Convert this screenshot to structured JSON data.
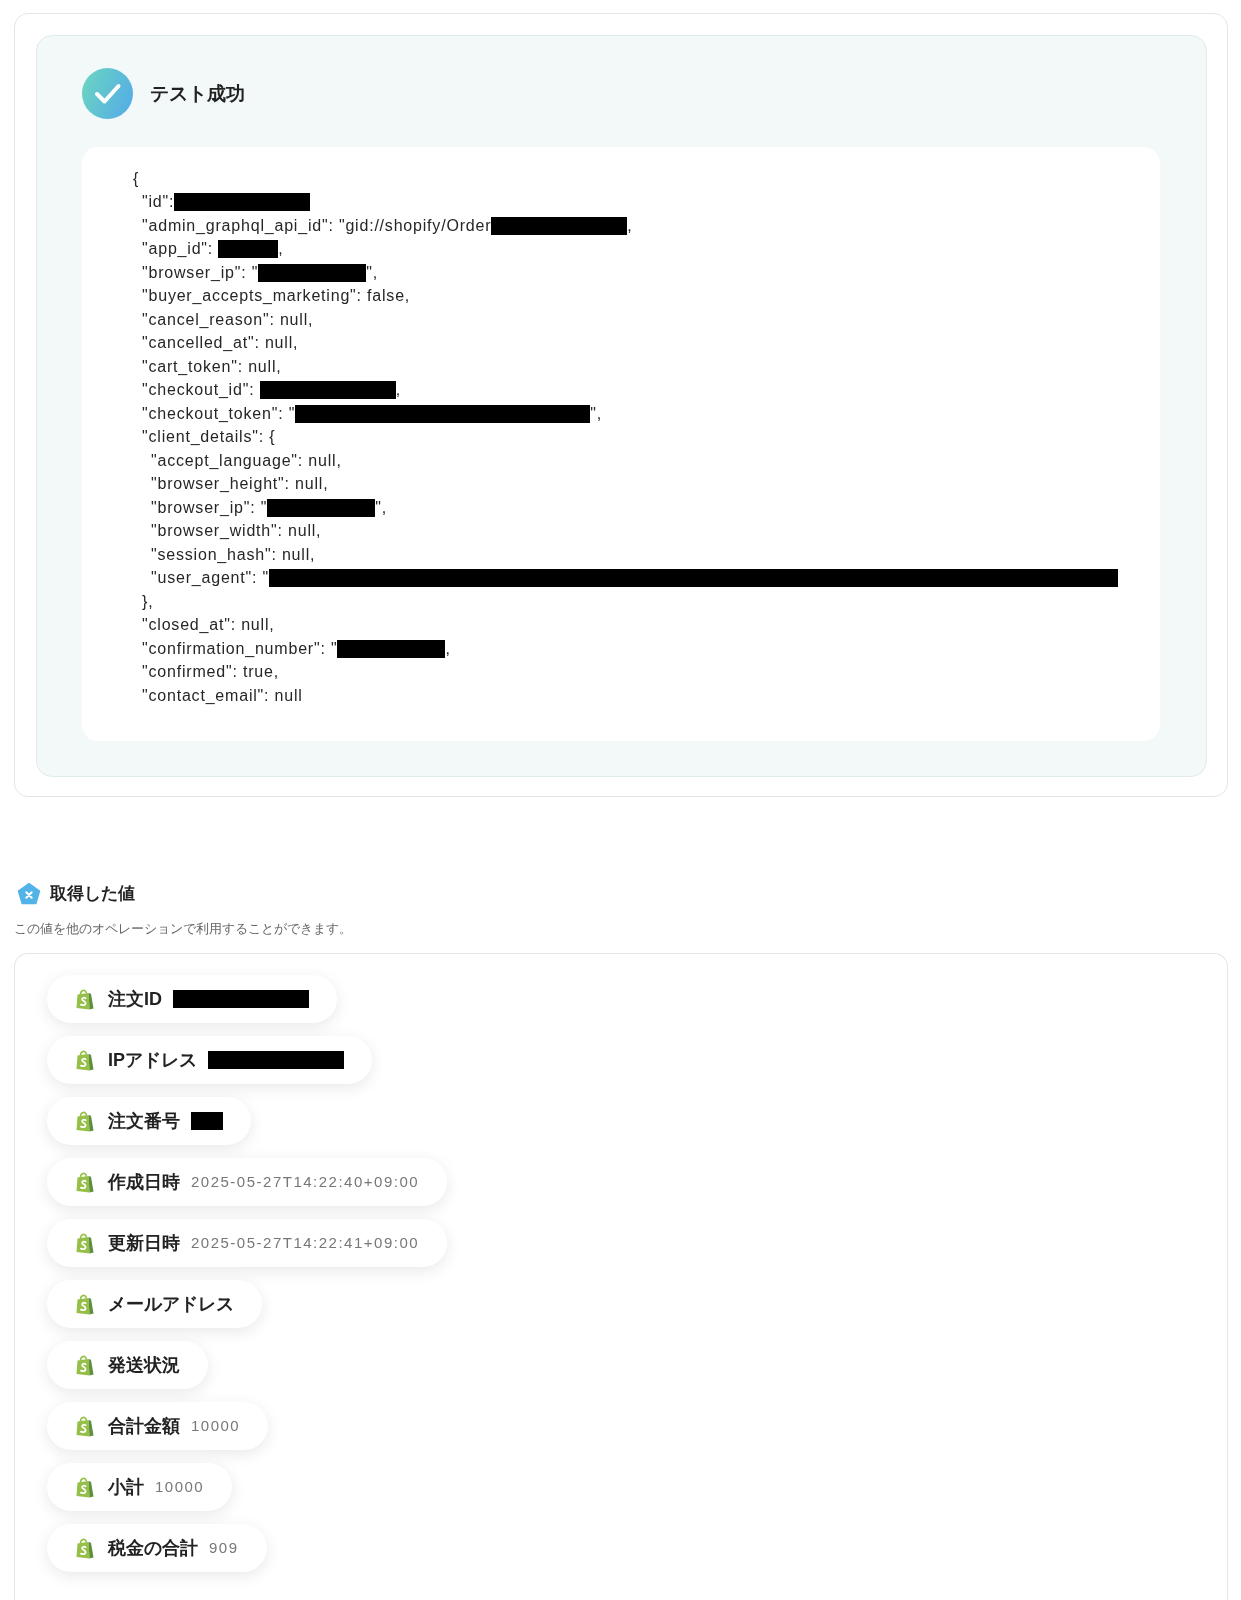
{
  "result": {
    "status_title": "テスト成功",
    "code": {
      "lines": [
        {
          "parts": [
            {
              "kind": "text",
              "text": "{"
            }
          ],
          "children": [
            {
              "parts": [
                {
                  "kind": "text",
                  "text": "\"id\":"
                },
                {
                  "kind": "mask_large"
                }
              ]
            },
            {
              "parts": [
                {
                  "kind": "text",
                  "text": "\"admin_graphql_api_id\": \"gid://shopify/Order"
                },
                {
                  "kind": "mask_large"
                },
                {
                  "kind": "text",
                  "text": ","
                }
              ]
            },
            {
              "parts": [
                {
                  "kind": "text",
                  "text": "\"app_id\": "
                },
                {
                  "kind": "mask_small"
                },
                {
                  "kind": "text",
                  "text": ","
                }
              ]
            },
            {
              "parts": [
                {
                  "kind": "text",
                  "text": "\"browser_ip\": \""
                },
                {
                  "kind": "mask_medium"
                },
                {
                  "kind": "text",
                  "text": "\","
                }
              ]
            },
            {
              "parts": [
                {
                  "kind": "text",
                  "text": "\"buyer_accepts_marketing\": false,"
                }
              ]
            },
            {
              "parts": [
                {
                  "kind": "text",
                  "text": "\"cancel_reason\": null,"
                }
              ]
            },
            {
              "parts": [
                {
                  "kind": "text",
                  "text": "\"cancelled_at\": null,"
                }
              ]
            },
            {
              "parts": [
                {
                  "kind": "text",
                  "text": "\"cart_token\": null,"
                }
              ]
            },
            {
              "parts": [
                {
                  "kind": "text",
                  "text": "\"checkout_id\": "
                },
                {
                  "kind": "mask_large"
                },
                {
                  "kind": "text",
                  "text": ","
                }
              ]
            },
            {
              "parts": [
                {
                  "kind": "text",
                  "text": "\"checkout_token\": \""
                },
                {
                  "kind": "mask_wide"
                },
                {
                  "kind": "text",
                  "text": "\","
                }
              ]
            },
            {
              "parts": [
                {
                  "kind": "text",
                  "text": "\"client_details\": {"
                }
              ],
              "children": [
                {
                  "parts": [
                    {
                      "kind": "text",
                      "text": "\"accept_language\": null,"
                    }
                  ]
                },
                {
                  "parts": [
                    {
                      "kind": "text",
                      "text": "\"browser_height\": null,"
                    }
                  ]
                },
                {
                  "parts": [
                    {
                      "kind": "text",
                      "text": "\"browser_ip\": \""
                    },
                    {
                      "kind": "mask_medium"
                    },
                    {
                      "kind": "text",
                      "text": "\","
                    }
                  ]
                },
                {
                  "parts": [
                    {
                      "kind": "text",
                      "text": "\"browser_width\": null,"
                    }
                  ]
                },
                {
                  "parts": [
                    {
                      "kind": "text",
                      "text": "\"session_hash\": null,"
                    }
                  ]
                },
                {
                  "parts": [
                    {
                      "kind": "text",
                      "text": "\"user_agent\": \""
                    },
                    {
                      "kind": "mask_full"
                    }
                  ]
                }
              ]
            },
            {
              "parts": [
                {
                  "kind": "text",
                  "text": "},"
                }
              ]
            },
            {
              "parts": [
                {
                  "kind": "text",
                  "text": "\"closed_at\": null,"
                }
              ]
            },
            {
              "parts": [
                {
                  "kind": "text",
                  "text": "\"confirmation_number\": \""
                },
                {
                  "kind": "mask_medium"
                },
                {
                  "kind": "text",
                  "text": ","
                }
              ]
            },
            {
              "parts": [
                {
                  "kind": "text",
                  "text": "\"confirmed\": true,"
                }
              ]
            },
            {
              "parts": [
                {
                  "kind": "text",
                  "text": "\"contact_email\": null"
                }
              ]
            }
          ]
        }
      ]
    }
  },
  "acquired_values": {
    "title": "取得した値",
    "description": "この値を他のオペレーションで利用することができます。",
    "items": [
      {
        "label": "注文ID",
        "parts": [
          {
            "kind": "mask_large"
          }
        ]
      },
      {
        "label": "IPアドレス",
        "parts": [
          {
            "kind": "mask_large"
          }
        ]
      },
      {
        "label": "注文番号",
        "parts": [
          {
            "kind": "mask_tiny"
          }
        ]
      },
      {
        "label": "作成日時",
        "parts": [
          {
            "kind": "text",
            "text": "2025-05-27T14:22:40+09:00"
          }
        ]
      },
      {
        "label": "更新日時",
        "parts": [
          {
            "kind": "text",
            "text": "2025-05-27T14:22:41+09:00"
          }
        ]
      },
      {
        "label": "メールアドレス"
      },
      {
        "label": "発送状況"
      },
      {
        "label": "合計金額",
        "parts": [
          {
            "kind": "text",
            "text": "10000"
          }
        ]
      },
      {
        "label": "小計",
        "parts": [
          {
            "kind": "text",
            "text": "10000"
          }
        ]
      },
      {
        "label": "税金の合計",
        "parts": [
          {
            "kind": "text",
            "text": "909"
          }
        ]
      }
    ]
  }
}
